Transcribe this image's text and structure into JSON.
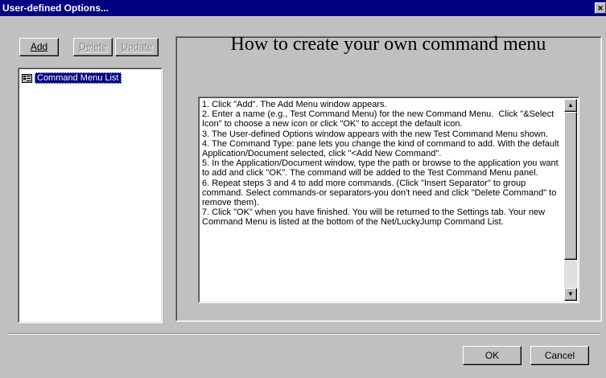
{
  "window": {
    "title": "User-defined Options...",
    "close_glyph": "×"
  },
  "toolbar": {
    "add_label": "Add",
    "delete_label": "Delete",
    "update_label": "Update"
  },
  "tree": {
    "items": [
      {
        "label": "Command Menu List",
        "icon": "list-folder-icon",
        "selected": true
      }
    ]
  },
  "help": {
    "heading": "How to create your own command menu",
    "text": "1. Click \"Add\". The Add Menu window appears.\n2. Enter a name (e.g., Test Command Menu) for the new Command Menu.  Click \"&Select Icon\" to choose a new icon or click \"OK\" to accept the default icon.\n3. The User-defined Options window appears with the new Test Command Menu shown.\n4. The Command Type: pane lets you change the kind of command to add. With the default Application/Document selected, click \"<Add New Command\".\n5. In the Application/Document window, type the path or browse to the application you want to add and click \"OK\". The command will be added to the Test Command Menu panel.\n6. Repeat steps 3 and 4 to add more commands. (Click \"Insert Separator\" to group command. Select commands-or separators-you don't need and click \"Delete Command\" to remove them).\n7. Click \"OK\" when you have finished. You will be returned to the Settings tab. Your new Command Menu is listed at the bottom of the Net/LuckyJump Command List."
  },
  "footer": {
    "ok_label": "OK",
    "cancel_label": "Cancel"
  },
  "colors": {
    "titlebar": "#000080",
    "face": "#c0c0c0",
    "selection": "#000080"
  }
}
